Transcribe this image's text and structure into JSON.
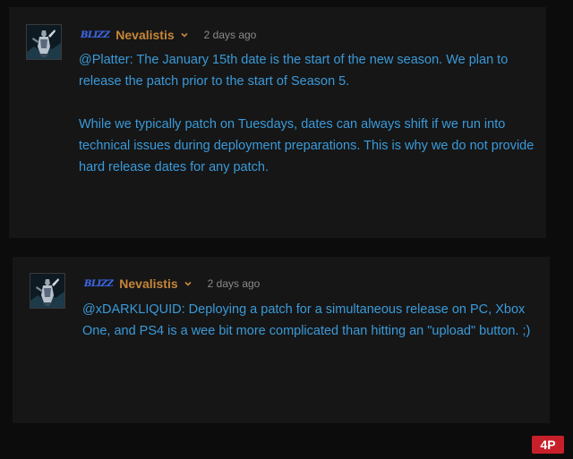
{
  "posts": [
    {
      "badge": "BLIZZ",
      "author": "Nevalistis",
      "time": "2 days ago",
      "paragraphs": [
        "@Platter: The January 15th date is the start of the new season. We plan to release the patch prior to the start of Season 5.",
        "While we typically patch on Tuesdays, dates can always shift if we run into technical issues during deployment preparations. This is why we do not provide hard release dates for any patch."
      ]
    },
    {
      "badge": "BLIZZ",
      "author": "Nevalistis",
      "time": "2 days ago",
      "paragraphs": [
        "@xDARKLIQUID: Deploying a patch for a simultaneous release on PC, Xbox One, and PS4 is a wee bit more complicated than hitting an \"upload\" button. ;)"
      ]
    }
  ],
  "watermark": "4P",
  "colors": {
    "background": "#0c0c0c",
    "panel": "#161616",
    "author": "#c7863a",
    "body_text": "#3a9ad9",
    "timestamp": "#8a8a8a",
    "blizz_badge": "#3f66d8",
    "watermark": "#c8202a"
  },
  "icons": {
    "author_menu": "chevron-down-icon",
    "avatar": "user-avatar"
  }
}
